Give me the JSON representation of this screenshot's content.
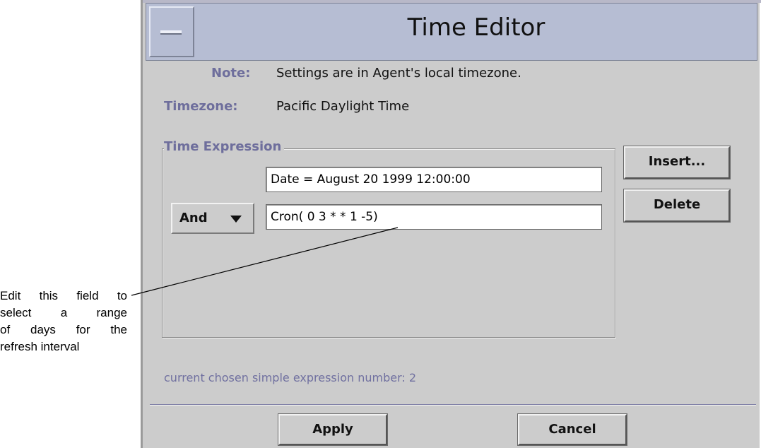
{
  "window": {
    "title": "Time Editor"
  },
  "info": {
    "note_label": "Note:",
    "note_value": "Settings are in Agent's local timezone.",
    "timezone_label": "Timezone:",
    "timezone_value": "Pacific Daylight Time"
  },
  "time_expression": {
    "group_label": "Time Expression",
    "expressions": [
      {
        "value": "Date = August 20 1999 12:00:00"
      },
      {
        "operator": "And",
        "value": "Cron( 0 3 * * 1 -5)"
      }
    ],
    "operator_icon": "chevron-down-icon"
  },
  "side_buttons": {
    "insert_label": "Insert...",
    "delete_label": "Delete"
  },
  "status": {
    "text": "current chosen simple expression number: 2"
  },
  "footer": {
    "apply_label": "Apply",
    "cancel_label": "Cancel"
  },
  "annotation": {
    "lines": [
      "Edit this field to",
      "select a range",
      "of days for the",
      "refresh interval"
    ]
  },
  "colors": {
    "titlebar": "#b6bdd3",
    "window_bg": "#cccccc",
    "label_accent": "#6e6e9c"
  }
}
